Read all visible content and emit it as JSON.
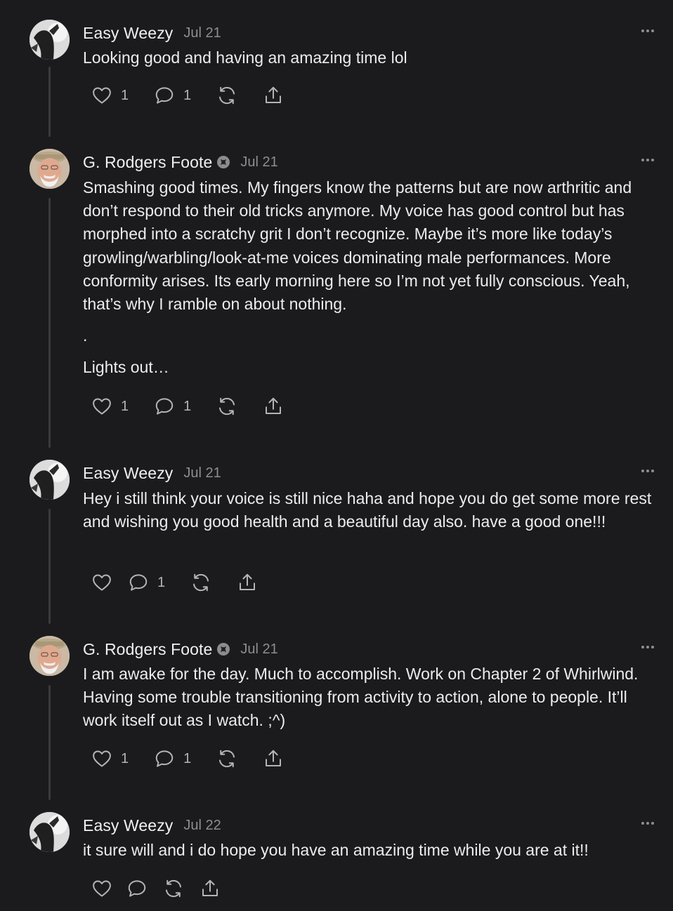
{
  "comments": [
    {
      "author": "Easy Weezy",
      "date": "Jul 21",
      "paragraphs": [
        "Looking good and having an amazing time lol"
      ],
      "likes": "1",
      "replies": "1"
    },
    {
      "author": "G. Rodgers Foote",
      "date": "Jul 21",
      "paragraphs": [
        "Smashing good times. My fingers know the patterns but are now arthritic and don’t respond to their old tricks anymore. My voice has good control but has morphed into a scratchy grit I don’t recognize. Maybe it’s more like today’s growling/warbling/look-at-me voices dominating male performances. More conformity arises. Its early morning here so I’m not yet fully conscious. Yeah, that’s why I ramble on about nothing.",
        ".",
        "Lights out…"
      ],
      "likes": "1",
      "replies": "1"
    },
    {
      "author": "Easy Weezy",
      "date": "Jul 21",
      "paragraphs": [
        "Hey i still think your voice is still nice haha and hope you do get some more rest and wishing you good health and a beautiful day also. have a good one!!!"
      ],
      "likes": "",
      "replies": "1"
    },
    {
      "author": "G. Rodgers Foote",
      "date": "Jul 21",
      "paragraphs": [
        "I am awake for the day. Much to accomplish. Work on Chapter 2 of Whirlwind. Having some trouble transitioning from activity to action, alone to people. It’ll work itself out as I watch. ;^)"
      ],
      "likes": "1",
      "replies": "1"
    },
    {
      "author": "Easy Weezy",
      "date": "Jul 22",
      "paragraphs": [
        "it sure will and i do hope you have an amazing time while you are at it!!"
      ],
      "likes": "",
      "replies": ""
    }
  ],
  "icons": {
    "like": "heart-icon",
    "reply": "comment-bubble-icon",
    "restack": "restack-icon",
    "share": "share-icon",
    "more": "more-horizontal-icon",
    "badge": "subscriber-badge-icon"
  },
  "colors": {
    "background": "#1b1b1d",
    "text": "#ececee",
    "muted": "#8d8d92",
    "icon": "#b4b4b8",
    "thread_line": "#3a3a3d"
  }
}
